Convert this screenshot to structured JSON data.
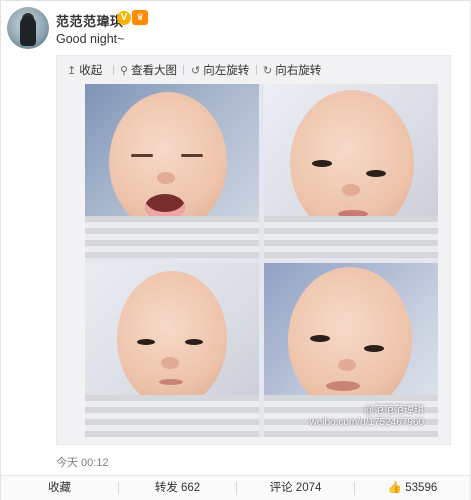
{
  "post": {
    "username": "范范范瑋琪",
    "verified_badge_text": "V",
    "member_badge_text": "♛",
    "text": "Good night~",
    "timestamp": "今天 00:12"
  },
  "toolbar": {
    "collapse": "收起",
    "view_large": "查看大图",
    "rotate_left": "向左旋转",
    "rotate_right": "向右旋转"
  },
  "watermark": {
    "handle": "@范范范瑋琪",
    "url": "weibo.com/u/1752467960"
  },
  "actions": {
    "favorite": "收藏",
    "repost": "转发 662",
    "comment": "评论 2074",
    "like": "53596"
  },
  "icons": {
    "collapse": "arrow-up-icon",
    "view_large": "magnifier-icon",
    "rotate_left": "rotate-left-icon",
    "rotate_right": "rotate-right-icon",
    "like": "thumbs-up-icon"
  },
  "colors": {
    "verified": "#f6b400",
    "member": "#ff8a00",
    "timestamp": "#808080"
  }
}
